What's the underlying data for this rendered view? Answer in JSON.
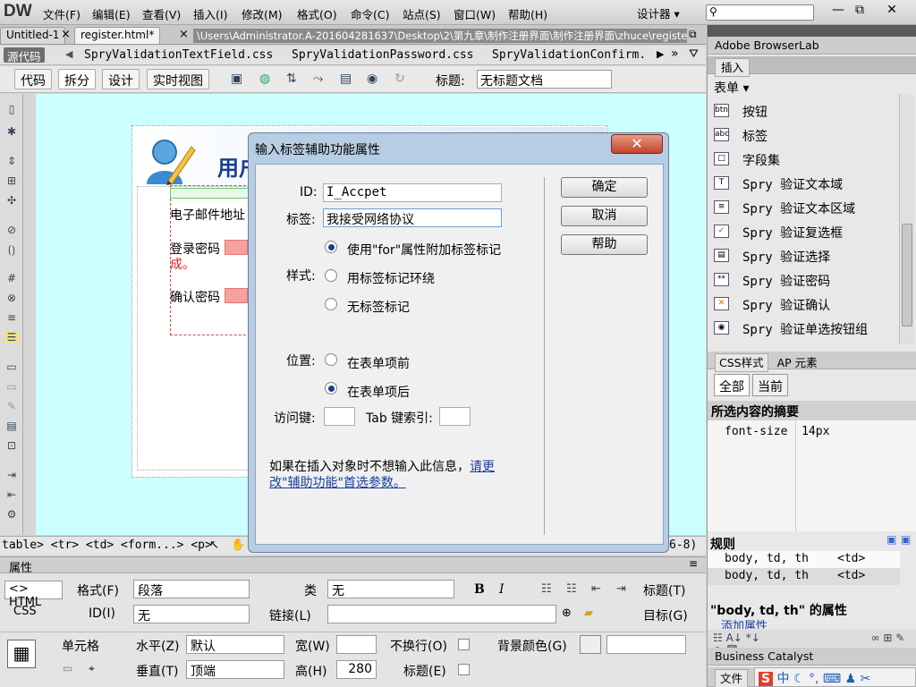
{
  "app": {
    "logo": "DW",
    "workspace": "设计器 ▾"
  },
  "menu": [
    "文件(F)",
    "编辑(E)",
    "查看(V)",
    "插入(I)",
    "修改(M)",
    "格式(O)",
    "命令(C)",
    "站点(S)",
    "窗口(W)",
    "帮助(H)"
  ],
  "window_controls": {
    "min": "—",
    "max": "⧉",
    "close": "✕"
  },
  "tabs": {
    "tab1": "Untitled-1",
    "tab1_close": "×",
    "tab2": "register.html*",
    "tab2_close": "×",
    "path": "\\Users\\Administrator.A-201604281637\\Desktop\\2\\第九章\\制作注册界面\\制作注册界面\\zhuce\\register.html"
  },
  "related_files": {
    "source": "源代码",
    "files": [
      "SpryValidationTextField.css",
      "SpryValidationPassword.css",
      "SpryValidationConfirm."
    ]
  },
  "view_bar": {
    "code": "代码",
    "split": "拆分",
    "design": "设计",
    "live": "实时视图",
    "title_label": "标题:",
    "title_value": "无标题文档"
  },
  "design": {
    "banner_title": "用户",
    "email_label": "电子邮件地址",
    "pwd_label": "登录密码",
    "pwd_hint": "成。",
    "confirm_label": "确认密码"
  },
  "tag_selector": {
    "path": "table> <tr> <td> <form...> <p>",
    "size": "6-8)"
  },
  "dialog": {
    "title": "输入标签辅助功能属性",
    "close": "✕",
    "id_label": "ID:",
    "id_value": "I_Accpet",
    "label_label": "标签:",
    "label_value": "我接受网络协议",
    "style_label": "样式:",
    "style_options": [
      "使用\"for\"属性附加标签标记",
      "用标签标记环绕",
      "无标签标记"
    ],
    "position_label": "位置:",
    "position_options": [
      "在表单项前",
      "在表单项后"
    ],
    "access_key_label": "访问键:",
    "tab_index_label": "Tab 键索引:",
    "note_text": "如果在插入对象时不想输入此信息，",
    "note_link": "请更改\"辅助功能\"首选参数。",
    "ok": "确定",
    "cancel": "取消",
    "help": "帮助"
  },
  "right_panel": {
    "browserlab": "Adobe BrowserLab",
    "insert_tab": "插入",
    "category": "表单 ▾",
    "items": [
      {
        "icon": "btn",
        "label": "按钮"
      },
      {
        "icon": "abc",
        "label": "标签"
      },
      {
        "icon": "□",
        "label": "字段集"
      },
      {
        "icon": "T",
        "label": "Spry 验证文本域"
      },
      {
        "icon": "≡",
        "label": "Spry 验证文本区域"
      },
      {
        "icon": "✓",
        "label": "Spry 验证复选框"
      },
      {
        "icon": "▤",
        "label": "Spry 验证选择"
      },
      {
        "icon": "**",
        "label": "Spry 验证密码"
      },
      {
        "icon": "✕",
        "label": "Spry 验证确认"
      },
      {
        "icon": "◉",
        "label": "Spry 验证单选按钮组"
      }
    ],
    "css_tab": "CSS样式",
    "ap_tab": "AP 元素",
    "all": "全部",
    "current": "当前",
    "summary_head": "所选内容的摘要",
    "summary_row": "font-size  14px",
    "rules_head": "规则",
    "rules": [
      {
        "sel": "body, td, th",
        "tag": "<td>"
      },
      {
        "sel": "body, td, th",
        "tag": "<td>"
      }
    ],
    "props_head": "\"body, td, th\" 的属性",
    "add_prop": "添加属性",
    "business_catalyst": "Business Catalyst",
    "files_tab": "文件"
  },
  "properties": {
    "title": "属性",
    "html_btn": "<> HTML",
    "css_btn": "CSS",
    "format_label": "格式(F)",
    "format_value": "段落",
    "class_label": "类",
    "class_value": "无",
    "id_label": "ID(I)",
    "id_value": "无",
    "link_label": "链接(L)",
    "title_label": "标题(T)",
    "target_label": "目标(G)",
    "cell_label": "单元格",
    "halign_label": "水平(Z)",
    "halign_value": "默认",
    "valign_label": "垂直(T)",
    "valign_value": "顶端",
    "width_label": "宽(W)",
    "height_label": "高(H)",
    "height_value": "280",
    "nowrap_label": "不换行(O)",
    "header_label": "标题(E)",
    "bg_label": "背景颜色(G)"
  }
}
